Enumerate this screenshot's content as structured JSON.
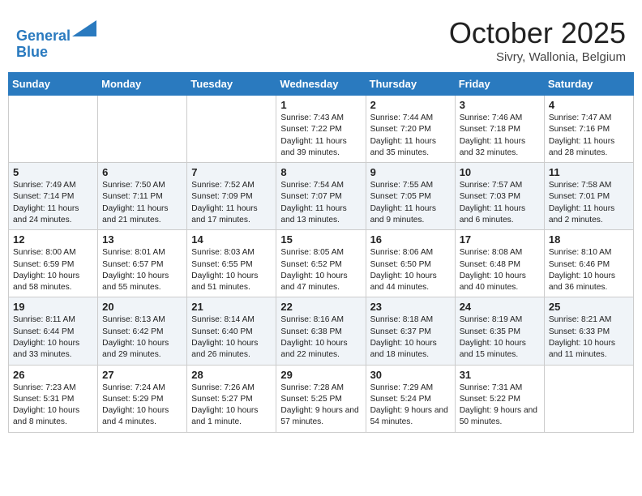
{
  "header": {
    "logo_line1": "General",
    "logo_line2": "Blue",
    "month": "October 2025",
    "location": "Sivry, Wallonia, Belgium"
  },
  "weekdays": [
    "Sunday",
    "Monday",
    "Tuesday",
    "Wednesday",
    "Thursday",
    "Friday",
    "Saturday"
  ],
  "weeks": [
    [
      {
        "day": "",
        "text": ""
      },
      {
        "day": "",
        "text": ""
      },
      {
        "day": "",
        "text": ""
      },
      {
        "day": "1",
        "text": "Sunrise: 7:43 AM\nSunset: 7:22 PM\nDaylight: 11 hours\nand 39 minutes."
      },
      {
        "day": "2",
        "text": "Sunrise: 7:44 AM\nSunset: 7:20 PM\nDaylight: 11 hours\nand 35 minutes."
      },
      {
        "day": "3",
        "text": "Sunrise: 7:46 AM\nSunset: 7:18 PM\nDaylight: 11 hours\nand 32 minutes."
      },
      {
        "day": "4",
        "text": "Sunrise: 7:47 AM\nSunset: 7:16 PM\nDaylight: 11 hours\nand 28 minutes."
      }
    ],
    [
      {
        "day": "5",
        "text": "Sunrise: 7:49 AM\nSunset: 7:14 PM\nDaylight: 11 hours\nand 24 minutes."
      },
      {
        "day": "6",
        "text": "Sunrise: 7:50 AM\nSunset: 7:11 PM\nDaylight: 11 hours\nand 21 minutes."
      },
      {
        "day": "7",
        "text": "Sunrise: 7:52 AM\nSunset: 7:09 PM\nDaylight: 11 hours\nand 17 minutes."
      },
      {
        "day": "8",
        "text": "Sunrise: 7:54 AM\nSunset: 7:07 PM\nDaylight: 11 hours\nand 13 minutes."
      },
      {
        "day": "9",
        "text": "Sunrise: 7:55 AM\nSunset: 7:05 PM\nDaylight: 11 hours\nand 9 minutes."
      },
      {
        "day": "10",
        "text": "Sunrise: 7:57 AM\nSunset: 7:03 PM\nDaylight: 11 hours\nand 6 minutes."
      },
      {
        "day": "11",
        "text": "Sunrise: 7:58 AM\nSunset: 7:01 PM\nDaylight: 11 hours\nand 2 minutes."
      }
    ],
    [
      {
        "day": "12",
        "text": "Sunrise: 8:00 AM\nSunset: 6:59 PM\nDaylight: 10 hours\nand 58 minutes."
      },
      {
        "day": "13",
        "text": "Sunrise: 8:01 AM\nSunset: 6:57 PM\nDaylight: 10 hours\nand 55 minutes."
      },
      {
        "day": "14",
        "text": "Sunrise: 8:03 AM\nSunset: 6:55 PM\nDaylight: 10 hours\nand 51 minutes."
      },
      {
        "day": "15",
        "text": "Sunrise: 8:05 AM\nSunset: 6:52 PM\nDaylight: 10 hours\nand 47 minutes."
      },
      {
        "day": "16",
        "text": "Sunrise: 8:06 AM\nSunset: 6:50 PM\nDaylight: 10 hours\nand 44 minutes."
      },
      {
        "day": "17",
        "text": "Sunrise: 8:08 AM\nSunset: 6:48 PM\nDaylight: 10 hours\nand 40 minutes."
      },
      {
        "day": "18",
        "text": "Sunrise: 8:10 AM\nSunset: 6:46 PM\nDaylight: 10 hours\nand 36 minutes."
      }
    ],
    [
      {
        "day": "19",
        "text": "Sunrise: 8:11 AM\nSunset: 6:44 PM\nDaylight: 10 hours\nand 33 minutes."
      },
      {
        "day": "20",
        "text": "Sunrise: 8:13 AM\nSunset: 6:42 PM\nDaylight: 10 hours\nand 29 minutes."
      },
      {
        "day": "21",
        "text": "Sunrise: 8:14 AM\nSunset: 6:40 PM\nDaylight: 10 hours\nand 26 minutes."
      },
      {
        "day": "22",
        "text": "Sunrise: 8:16 AM\nSunset: 6:38 PM\nDaylight: 10 hours\nand 22 minutes."
      },
      {
        "day": "23",
        "text": "Sunrise: 8:18 AM\nSunset: 6:37 PM\nDaylight: 10 hours\nand 18 minutes."
      },
      {
        "day": "24",
        "text": "Sunrise: 8:19 AM\nSunset: 6:35 PM\nDaylight: 10 hours\nand 15 minutes."
      },
      {
        "day": "25",
        "text": "Sunrise: 8:21 AM\nSunset: 6:33 PM\nDaylight: 10 hours\nand 11 minutes."
      }
    ],
    [
      {
        "day": "26",
        "text": "Sunrise: 7:23 AM\nSunset: 5:31 PM\nDaylight: 10 hours\nand 8 minutes."
      },
      {
        "day": "27",
        "text": "Sunrise: 7:24 AM\nSunset: 5:29 PM\nDaylight: 10 hours\nand 4 minutes."
      },
      {
        "day": "28",
        "text": "Sunrise: 7:26 AM\nSunset: 5:27 PM\nDaylight: 10 hours\nand 1 minute."
      },
      {
        "day": "29",
        "text": "Sunrise: 7:28 AM\nSunset: 5:25 PM\nDaylight: 9 hours\nand 57 minutes."
      },
      {
        "day": "30",
        "text": "Sunrise: 7:29 AM\nSunset: 5:24 PM\nDaylight: 9 hours\nand 54 minutes."
      },
      {
        "day": "31",
        "text": "Sunrise: 7:31 AM\nSunset: 5:22 PM\nDaylight: 9 hours\nand 50 minutes."
      },
      {
        "day": "",
        "text": ""
      }
    ]
  ]
}
